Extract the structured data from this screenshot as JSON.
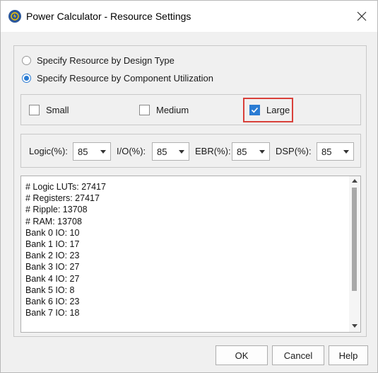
{
  "window": {
    "title": "Power Calculator - Resource Settings",
    "icon": "power-calculator-icon",
    "close_icon": "close-icon"
  },
  "resource_mode": {
    "options": [
      {
        "label": "Specify Resource by Design Type",
        "selected": false
      },
      {
        "label": "Specify Resource by Component Utilization",
        "selected": true
      }
    ]
  },
  "size": {
    "options": [
      {
        "label": "Small",
        "checked": false
      },
      {
        "label": "Medium",
        "checked": false
      },
      {
        "label": "Large",
        "checked": true
      }
    ],
    "highlight_color": "#d9403a"
  },
  "utilization": {
    "logic": {
      "label": "Logic(%):",
      "value": "85"
    },
    "io": {
      "label": "I/O(%):",
      "value": "85"
    },
    "ebr": {
      "label": "EBR(%):",
      "value": "85"
    },
    "dsp": {
      "label": "DSP(%):",
      "value": "85"
    }
  },
  "summary_lines": [
    "# Logic LUTs: 27417",
    "# Registers: 27417",
    "# Ripple: 13708",
    "# RAM: 13708",
    "Bank 0 IO: 10",
    "Bank 1 IO: 17",
    "Bank 2 IO: 23",
    "Bank 3 IO: 27",
    "Bank 4 IO: 27",
    "Bank 5 IO: 8",
    "Bank 6 IO: 23",
    "Bank 7 IO: 18"
  ],
  "buttons": {
    "ok": "OK",
    "cancel": "Cancel",
    "help": "Help"
  },
  "colors": {
    "accent": "#2b7cd3",
    "dialog_bg": "#f0f0f0"
  }
}
